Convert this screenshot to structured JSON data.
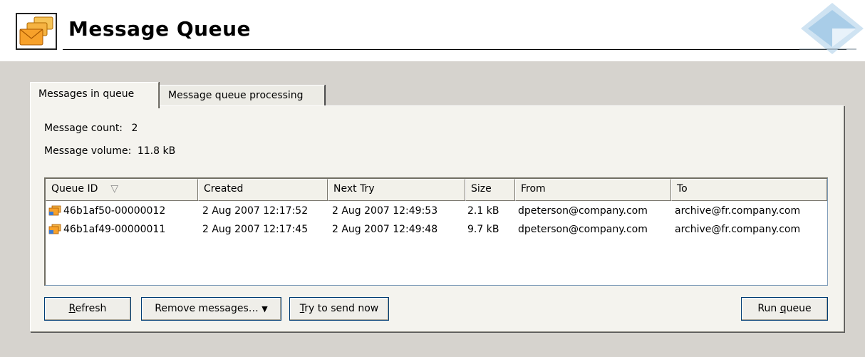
{
  "header": {
    "title": "Message Queue",
    "app_icon": "stacked-envelopes-icon",
    "brand_logo": "blue-diamond-logo"
  },
  "tabs": [
    {
      "label": "Messages in queue",
      "active": true
    },
    {
      "label": "Message queue processing",
      "active": false
    }
  ],
  "stats": {
    "count_label": "Message count:",
    "count_value": "2",
    "volume_label": "Message volume:",
    "volume_value": "11.8 kB"
  },
  "table": {
    "columns": [
      "Queue ID",
      "Created",
      "Next Try",
      "Size",
      "From",
      "To"
    ],
    "sort_indicator": "▽",
    "rows": [
      {
        "id": "46b1af50-00000012",
        "created": "2 Aug 2007 12:17:52",
        "next_try": "2 Aug 2007 12:49:53",
        "size": "2.1 kB",
        "from": "dpeterson@company.com",
        "to": "archive@fr.company.com"
      },
      {
        "id": "46b1af49-00000011",
        "created": "2 Aug 2007 12:17:45",
        "next_try": "2 Aug 2007 12:49:48",
        "size": "9.7 kB",
        "from": "dpeterson@company.com",
        "to": "archive@fr.company.com"
      }
    ]
  },
  "buttons": {
    "refresh_first": "R",
    "refresh_rest": "efresh",
    "remove": "Remove messages…",
    "remove_arrow": "▼",
    "try_first": "T",
    "try_rest": "ry to send now",
    "run_a": "Run ",
    "run_u": "q",
    "run_b": "ueue"
  },
  "colors": {
    "background": "#d6d3ce",
    "panel": "#f4f3ee",
    "button_border": "#003c74"
  }
}
